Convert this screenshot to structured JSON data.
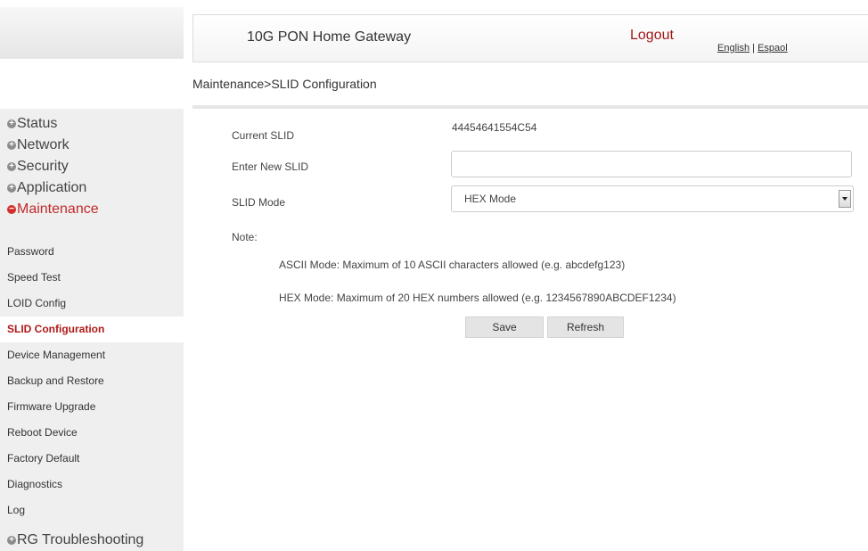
{
  "header": {
    "title": "10G PON Home Gateway",
    "logout": "Logout",
    "lang_english": "English",
    "lang_separator": "|",
    "lang_espanol": "Espaol"
  },
  "breadcrumb": "Maintenance>SLID Configuration",
  "sidebar": {
    "main": [
      {
        "label": "Status",
        "icon": "plus-icon"
      },
      {
        "label": "Network",
        "icon": "plus-icon"
      },
      {
        "label": "Security",
        "icon": "plus-icon"
      },
      {
        "label": "Application",
        "icon": "plus-icon"
      },
      {
        "label": "Maintenance",
        "icon": "minus-icon"
      }
    ],
    "sub": [
      "Password",
      "Speed Test",
      "LOID Config",
      "SLID Configuration",
      "Device Management",
      "Backup and Restore",
      "Firmware Upgrade",
      "Reboot Device",
      "Factory Default",
      "Diagnostics",
      "Log"
    ],
    "last": {
      "label": "RG Troubleshooting",
      "icon": "plus-icon"
    }
  },
  "form": {
    "current_slid_label": "Current SLID",
    "current_slid_value": "44454641554C54",
    "new_slid_label": "Enter New SLID",
    "new_slid_value": "",
    "mode_label": "SLID Mode",
    "mode_value": "HEX Mode",
    "note_label": "Note:",
    "note_ascii": "ASCII Mode: Maximum of 10 ASCII characters allowed (e.g. abcdefg123)",
    "note_hex": "HEX Mode: Maximum of 20 HEX numbers allowed (e.g. 1234567890ABCDEF1234)",
    "save": "Save",
    "refresh": "Refresh"
  },
  "colors": {
    "accent": "#a01919",
    "active_text": "#b01818",
    "sidebar_bg": "#efefef"
  }
}
